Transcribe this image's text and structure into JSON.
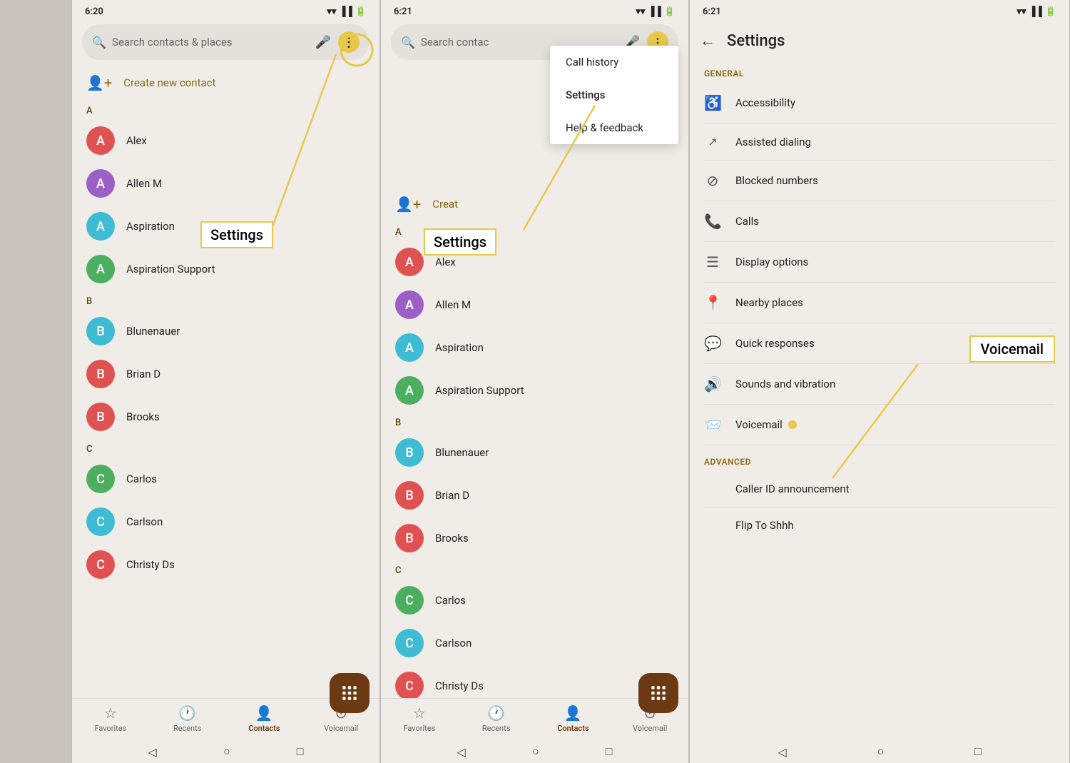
{
  "screen1": {
    "time": "6:20",
    "search_placeholder": "Search contacts & places",
    "create_contact_label": "Create new contact",
    "sections": [
      {
        "letter": "A",
        "contacts": [
          {
            "name": "Alex",
            "color": "#e05252",
            "initial": "A"
          },
          {
            "name": "Allen M",
            "color": "#9c5fc5",
            "initial": "A"
          },
          {
            "name": "Aspiration",
            "color": "#3dbcd4",
            "initial": "A"
          },
          {
            "name": "Aspiration Support",
            "color": "#4caf60",
            "initial": "A"
          }
        ]
      },
      {
        "letter": "B",
        "contacts": [
          {
            "name": "Blunenauer",
            "color": "#3dbcd4",
            "initial": "B"
          },
          {
            "name": "Brian D",
            "color": "#e05252",
            "initial": "B"
          },
          {
            "name": "Brooks",
            "color": "#e05252",
            "initial": "B"
          }
        ]
      },
      {
        "letter": "C",
        "contacts": [
          {
            "name": "Carlos",
            "color": "#4caf60",
            "initial": "C"
          },
          {
            "name": "Carlson",
            "color": "#3dbcd4",
            "initial": "C"
          },
          {
            "name": "Christy Ds",
            "color": "#e05252",
            "initial": "C"
          }
        ]
      }
    ],
    "nav": {
      "items": [
        {
          "label": "Favorites",
          "icon": "☆",
          "active": false
        },
        {
          "label": "Recents",
          "icon": "🕐",
          "active": false
        },
        {
          "label": "Contacts",
          "icon": "👤",
          "active": true
        },
        {
          "label": "Voicemail",
          "icon": "⊙",
          "active": false
        }
      ]
    },
    "annotation_dots": "⋮",
    "annotation_label": "Settings"
  },
  "screen2": {
    "time": "6:21",
    "search_placeholder": "Search contac",
    "dropdown": {
      "items": [
        "Call history",
        "Settings",
        "Help & feedback"
      ]
    },
    "create_contact_label": "Creat",
    "sections": [
      {
        "letter": "A",
        "contacts": [
          {
            "name": "Alex",
            "color": "#e05252",
            "initial": "A"
          },
          {
            "name": "Allen M",
            "color": "#9c5fc5",
            "initial": "A"
          },
          {
            "name": "Aspiration",
            "color": "#3dbcd4",
            "initial": "A"
          },
          {
            "name": "Aspiration Support",
            "color": "#4caf60",
            "initial": "A"
          }
        ]
      },
      {
        "letter": "B",
        "contacts": [
          {
            "name": "Blunenauer",
            "color": "#3dbcd4",
            "initial": "B"
          },
          {
            "name": "Brian D",
            "color": "#e05252",
            "initial": "B"
          },
          {
            "name": "Brooks",
            "color": "#e05252",
            "initial": "B"
          }
        ]
      },
      {
        "letter": "C",
        "contacts": [
          {
            "name": "Carlos",
            "color": "#4caf60",
            "initial": "C"
          },
          {
            "name": "Carlson",
            "color": "#3dbcd4",
            "initial": "C"
          },
          {
            "name": "Christy Ds",
            "color": "#e05252",
            "initial": "C"
          }
        ]
      }
    ],
    "nav": {
      "items": [
        {
          "label": "Favorites",
          "icon": "☆",
          "active": false
        },
        {
          "label": "Recents",
          "icon": "🕐",
          "active": false
        },
        {
          "label": "Contacts",
          "icon": "👤",
          "active": true
        },
        {
          "label": "Voicemail",
          "icon": "⊙",
          "active": false
        }
      ]
    },
    "annotation_label": "Settings"
  },
  "screen3": {
    "time": "6:21",
    "title": "Settings",
    "sections": [
      {
        "header": "GENERAL",
        "items": [
          {
            "icon": "♿",
            "label": "Accessibility"
          },
          {
            "icon": "📞",
            "label": "Assisted dialing"
          },
          {
            "icon": "🚫",
            "label": "Blocked numbers"
          },
          {
            "icon": "📱",
            "label": "Calls"
          },
          {
            "icon": "≡",
            "label": "Display options"
          },
          {
            "icon": "📍",
            "label": "Nearby places"
          },
          {
            "icon": "💬",
            "label": "Quick responses"
          },
          {
            "icon": "🔊",
            "label": "Sounds and vibration"
          },
          {
            "icon": "📨",
            "label": "Voicemail"
          }
        ]
      },
      {
        "header": "ADVANCED",
        "items": [
          {
            "icon": "",
            "label": "Caller ID announcement"
          },
          {
            "icon": "",
            "label": "Flip To Shhh"
          }
        ]
      }
    ],
    "annotation_voicemail": "Voicemail"
  },
  "colors": {
    "accent": "#e8c84a",
    "brand_brown": "#6b3a12",
    "text_gold": "#8b6914",
    "bg": "#f0ede8"
  }
}
